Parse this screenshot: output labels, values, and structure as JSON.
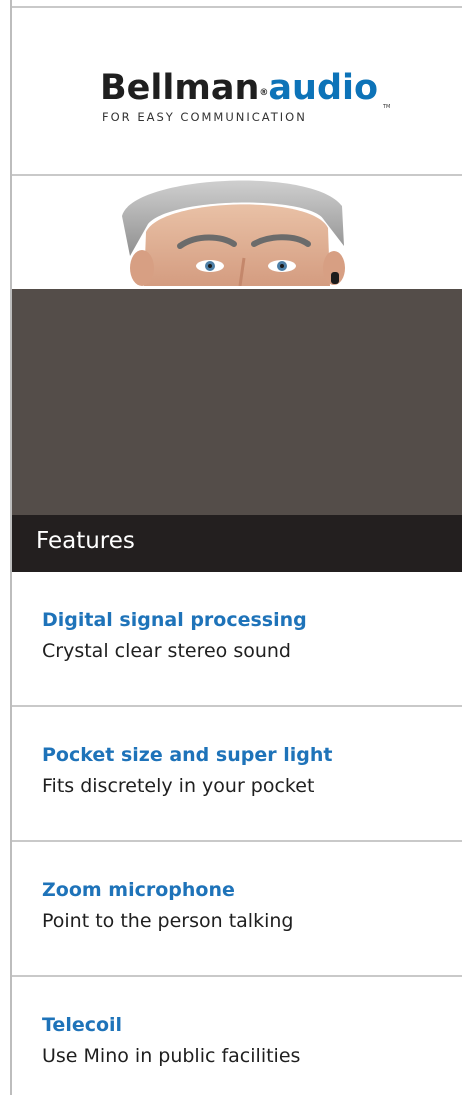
{
  "brand": {
    "name_part1": "Bellman",
    "registered": "®",
    "name_part2": "audio",
    "tagline": "FOR EASY COMMUNICATION",
    "trademark": "TM"
  },
  "hero": {
    "image": "man-with-hearing-aid-photo"
  },
  "features": {
    "heading": "Features",
    "items": [
      {
        "title": "Digital signal processing",
        "description": "Crystal clear stereo sound"
      },
      {
        "title": "Pocket size and super light",
        "description": "Fits discretely in your pocket"
      },
      {
        "title": "Zoom microphone",
        "description": "Point to the person talking"
      },
      {
        "title": "Telecoil",
        "description": "Use Mino in public facilities"
      }
    ]
  },
  "colors": {
    "brand_blue": "#0d73b8",
    "feature_title": "#1e73b9",
    "dark_panel": "#544d49",
    "features_bar": "#231f1f"
  }
}
